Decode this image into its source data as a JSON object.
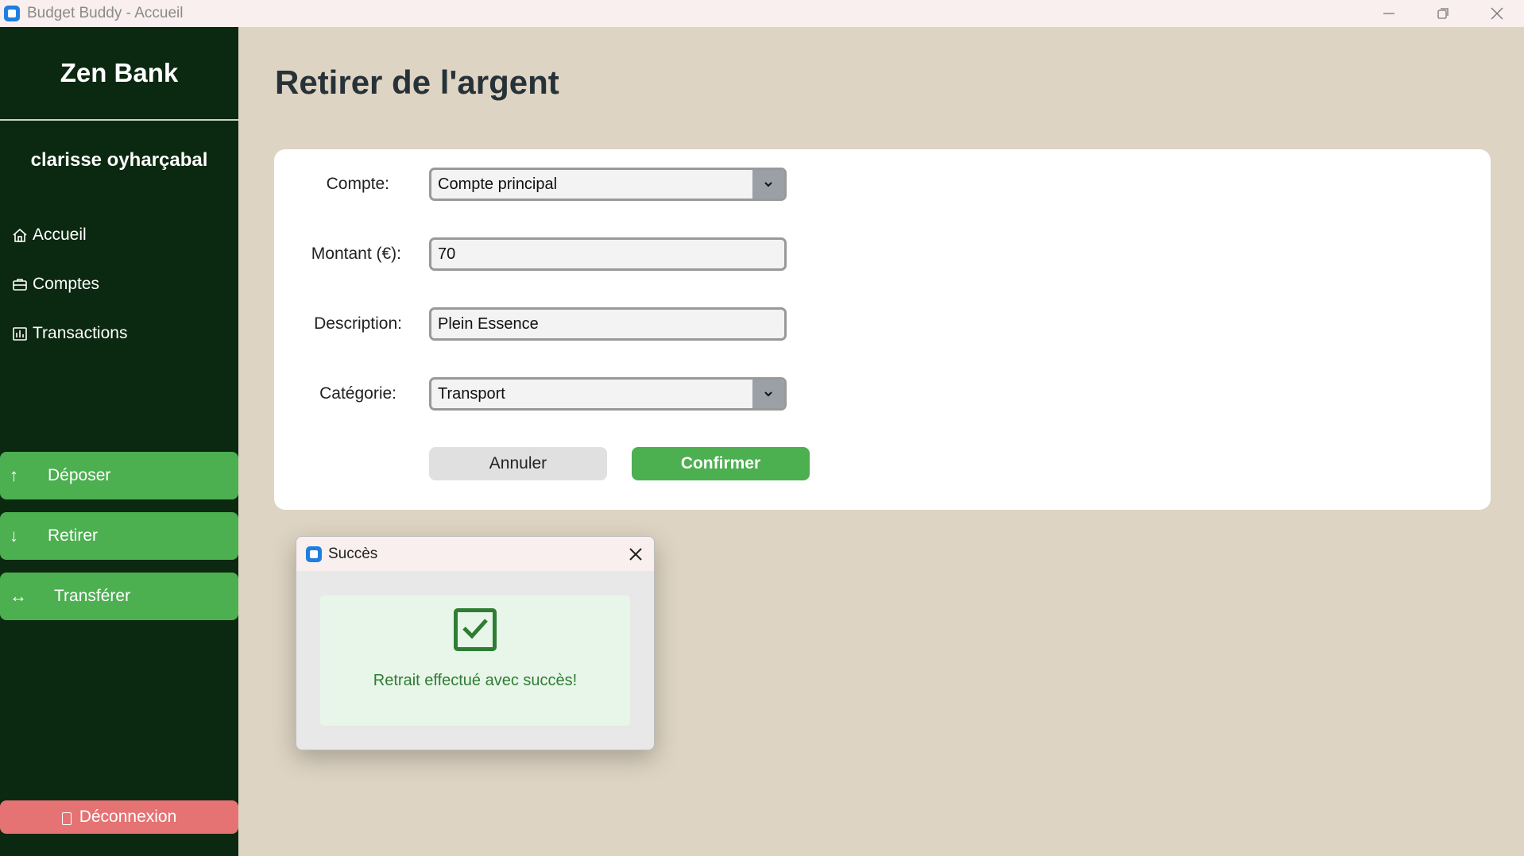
{
  "window": {
    "title": "Budget Buddy - Accueil"
  },
  "sidebar": {
    "brand": "Zen Bank",
    "user": "clarisse oyharçabal",
    "nav": [
      {
        "label": "Accueil",
        "icon": "home-icon"
      },
      {
        "label": "Comptes",
        "icon": "briefcase-icon"
      },
      {
        "label": "Transactions",
        "icon": "bar-chart-icon"
      }
    ],
    "actions": [
      {
        "label": "Déposer",
        "icon": "↑"
      },
      {
        "label": "Retirer",
        "icon": "↓"
      },
      {
        "label": "Transférer",
        "icon": "↔"
      }
    ],
    "logout": "Déconnexion"
  },
  "main": {
    "title": "Retirer de l'argent",
    "form": {
      "account_label": "Compte:",
      "account_value": "Compte principal",
      "amount_label": "Montant (€):",
      "amount_value": "70",
      "description_label": "Description:",
      "description_value": "Plein Essence",
      "category_label": "Catégorie:",
      "category_value": "Transport",
      "cancel": "Annuler",
      "confirm": "Confirmer"
    }
  },
  "dialog": {
    "title": "Succès",
    "message": "Retrait effectué avec succès!"
  },
  "colors": {
    "sidebar": "#0b2810",
    "accent": "#4caf50",
    "danger": "#e57373",
    "background": "#ded4c3",
    "success_text": "#2e7d32"
  }
}
